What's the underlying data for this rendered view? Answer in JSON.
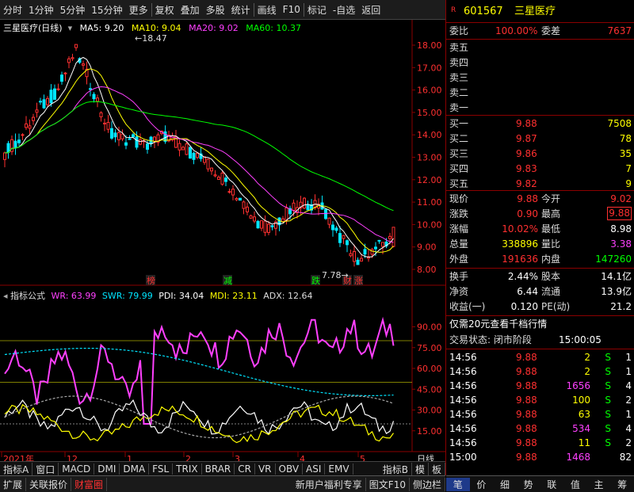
{
  "toolbar": {
    "items": [
      "分时",
      "1分钟",
      "5分钟",
      "15分钟",
      "更多",
      "复权",
      "叠加",
      "多股",
      "统计",
      "画线",
      "F10",
      "标记",
      "-自选",
      "返回"
    ]
  },
  "chart": {
    "title": "三星医疗(日线)",
    "ma5": "MA5: 9.20",
    "ma10": "MA10: 9.04",
    "ma20": "MA20: 9.02",
    "ma60": "MA60: 10.37",
    "high_label": "18.47",
    "low_label": "7.78",
    "y_ticks": [
      "18.00",
      "17.00",
      "16.00",
      "15.00",
      "14.00",
      "13.00",
      "12.00",
      "11.00",
      "10.00",
      "9.00",
      "8.00"
    ],
    "markers": [
      "榜",
      "减",
      "跌",
      "财",
      "涨"
    ],
    "colors": {
      "ma5": "#ffffff",
      "ma10": "#ffff00",
      "ma20": "#ff40ff",
      "ma60": "#00ff00",
      "up": "#ff3030",
      "down": "#00e5ff"
    }
  },
  "indicator": {
    "name": "指标公式",
    "wr": "WR: 63.99",
    "swr": "SWR: 79.99",
    "pdi": "PDI: 34.04",
    "mdi": "MDI: 23.11",
    "adx": "ADX: 12.64",
    "y_ticks": [
      "90.00",
      "75.00",
      "60.00",
      "45.00",
      "30.00",
      "15.00"
    ]
  },
  "xaxis": {
    "labels": [
      "2021年",
      "12",
      "1",
      "2",
      "3",
      "4",
      "5"
    ],
    "period": "日线"
  },
  "bottom_tabs": {
    "row1": [
      "指标A",
      "窗口",
      "MACD",
      "DMI",
      "DMA",
      "FSL",
      "TRIX",
      "BRAR",
      "CR",
      "VR",
      "OBV",
      "ASI",
      "EMV",
      "指标B",
      "模",
      "板"
    ],
    "row2": [
      "扩展",
      "关联报价",
      "财富圈",
      "新用户福利专享",
      "图文F10",
      "侧边栏"
    ]
  },
  "right_panel": {
    "r_badge": "R",
    "code": "601567",
    "name": "三星医疗",
    "weibi_label": "委比",
    "weibi_value": "100.00%",
    "weicha_label": "委差",
    "weicha_value": "7637",
    "sells": [
      "卖五",
      "卖四",
      "卖三",
      "卖二",
      "卖一"
    ],
    "buys": [
      {
        "label": "买一",
        "price": "9.88",
        "vol": "7508"
      },
      {
        "label": "买二",
        "price": "9.87",
        "vol": "78"
      },
      {
        "label": "买三",
        "price": "9.86",
        "vol": "35"
      },
      {
        "label": "买四",
        "price": "9.83",
        "vol": "7"
      },
      {
        "label": "买五",
        "price": "9.82",
        "vol": "9"
      }
    ],
    "quote": [
      {
        "l1": "现价",
        "v1": "9.88",
        "l2": "今开",
        "v2": "9.02"
      },
      {
        "l1": "涨跌",
        "v1": "0.90",
        "l2": "最高",
        "v2": "9.88"
      },
      {
        "l1": "涨幅",
        "v1": "10.02%",
        "l2": "最低",
        "v2": "8.98"
      },
      {
        "l1": "总量",
        "v1": "338896",
        "l2": "量比",
        "v2": "3.38"
      },
      {
        "l1": "外盘",
        "v1": "191636",
        "l2": "内盘",
        "v2": "147260"
      }
    ],
    "stats": [
      {
        "l1": "换手",
        "v1": "2.44%",
        "l2": "股本",
        "v2": "14.1亿"
      },
      {
        "l1": "净资",
        "v1": "6.44",
        "l2": "流通",
        "v2": "13.9亿"
      },
      {
        "l1": "收益(一)",
        "v1": "0.120",
        "l2": "PE(动)",
        "v2": "21.2"
      }
    ],
    "promo": "仅需20元查看千档行情",
    "trade_status_label": "交易状态: 闭市阶段",
    "trade_status_time": "15:00:05",
    "ticks": [
      {
        "t": "14:56",
        "p": "9.88",
        "v": "2",
        "s": "S",
        "n": "1"
      },
      {
        "t": "14:56",
        "p": "9.88",
        "v": "2",
        "s": "S",
        "n": "1"
      },
      {
        "t": "14:56",
        "p": "9.88",
        "v": "1656",
        "s": "S",
        "n": "4"
      },
      {
        "t": "14:56",
        "p": "9.88",
        "v": "100",
        "s": "S",
        "n": "2"
      },
      {
        "t": "14:56",
        "p": "9.88",
        "v": "63",
        "s": "S",
        "n": "1"
      },
      {
        "t": "14:56",
        "p": "9.88",
        "v": "534",
        "s": "S",
        "n": "4"
      },
      {
        "t": "14:56",
        "p": "9.88",
        "v": "11",
        "s": "S",
        "n": "2"
      },
      {
        "t": "15:00",
        "p": "9.88",
        "v": "1468",
        "s": "",
        "n": "82"
      }
    ],
    "bottom_tabs": [
      "笔",
      "价",
      "细",
      "势",
      "联",
      "值",
      "主",
      "筹"
    ]
  }
}
